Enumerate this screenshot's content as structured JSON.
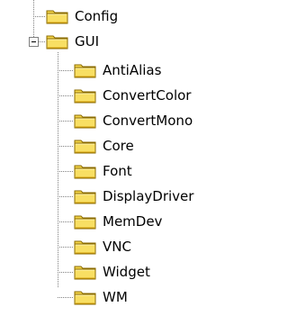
{
  "tree": {
    "top_items": [
      {
        "label": "Config",
        "icon": "folder-icon",
        "expanded": false
      },
      {
        "label": "GUI",
        "icon": "folder-icon",
        "expanded": true
      }
    ],
    "gui_children": [
      {
        "label": "AntiAlias",
        "icon": "folder-icon"
      },
      {
        "label": "ConvertColor",
        "icon": "folder-icon"
      },
      {
        "label": "ConvertMono",
        "icon": "folder-icon"
      },
      {
        "label": "Core",
        "icon": "folder-icon"
      },
      {
        "label": "Font",
        "icon": "folder-icon"
      },
      {
        "label": "DisplayDriver",
        "icon": "folder-icon"
      },
      {
        "label": "MemDev",
        "icon": "folder-icon"
      },
      {
        "label": "VNC",
        "icon": "folder-icon"
      },
      {
        "label": "Widget",
        "icon": "folder-icon"
      },
      {
        "label": "WM",
        "icon": "folder-icon"
      }
    ],
    "colors": {
      "folder_fill": "#f4d64a",
      "folder_shade": "#d6a10f",
      "folder_outline": "#8b6b00",
      "connector": "#808080"
    }
  }
}
